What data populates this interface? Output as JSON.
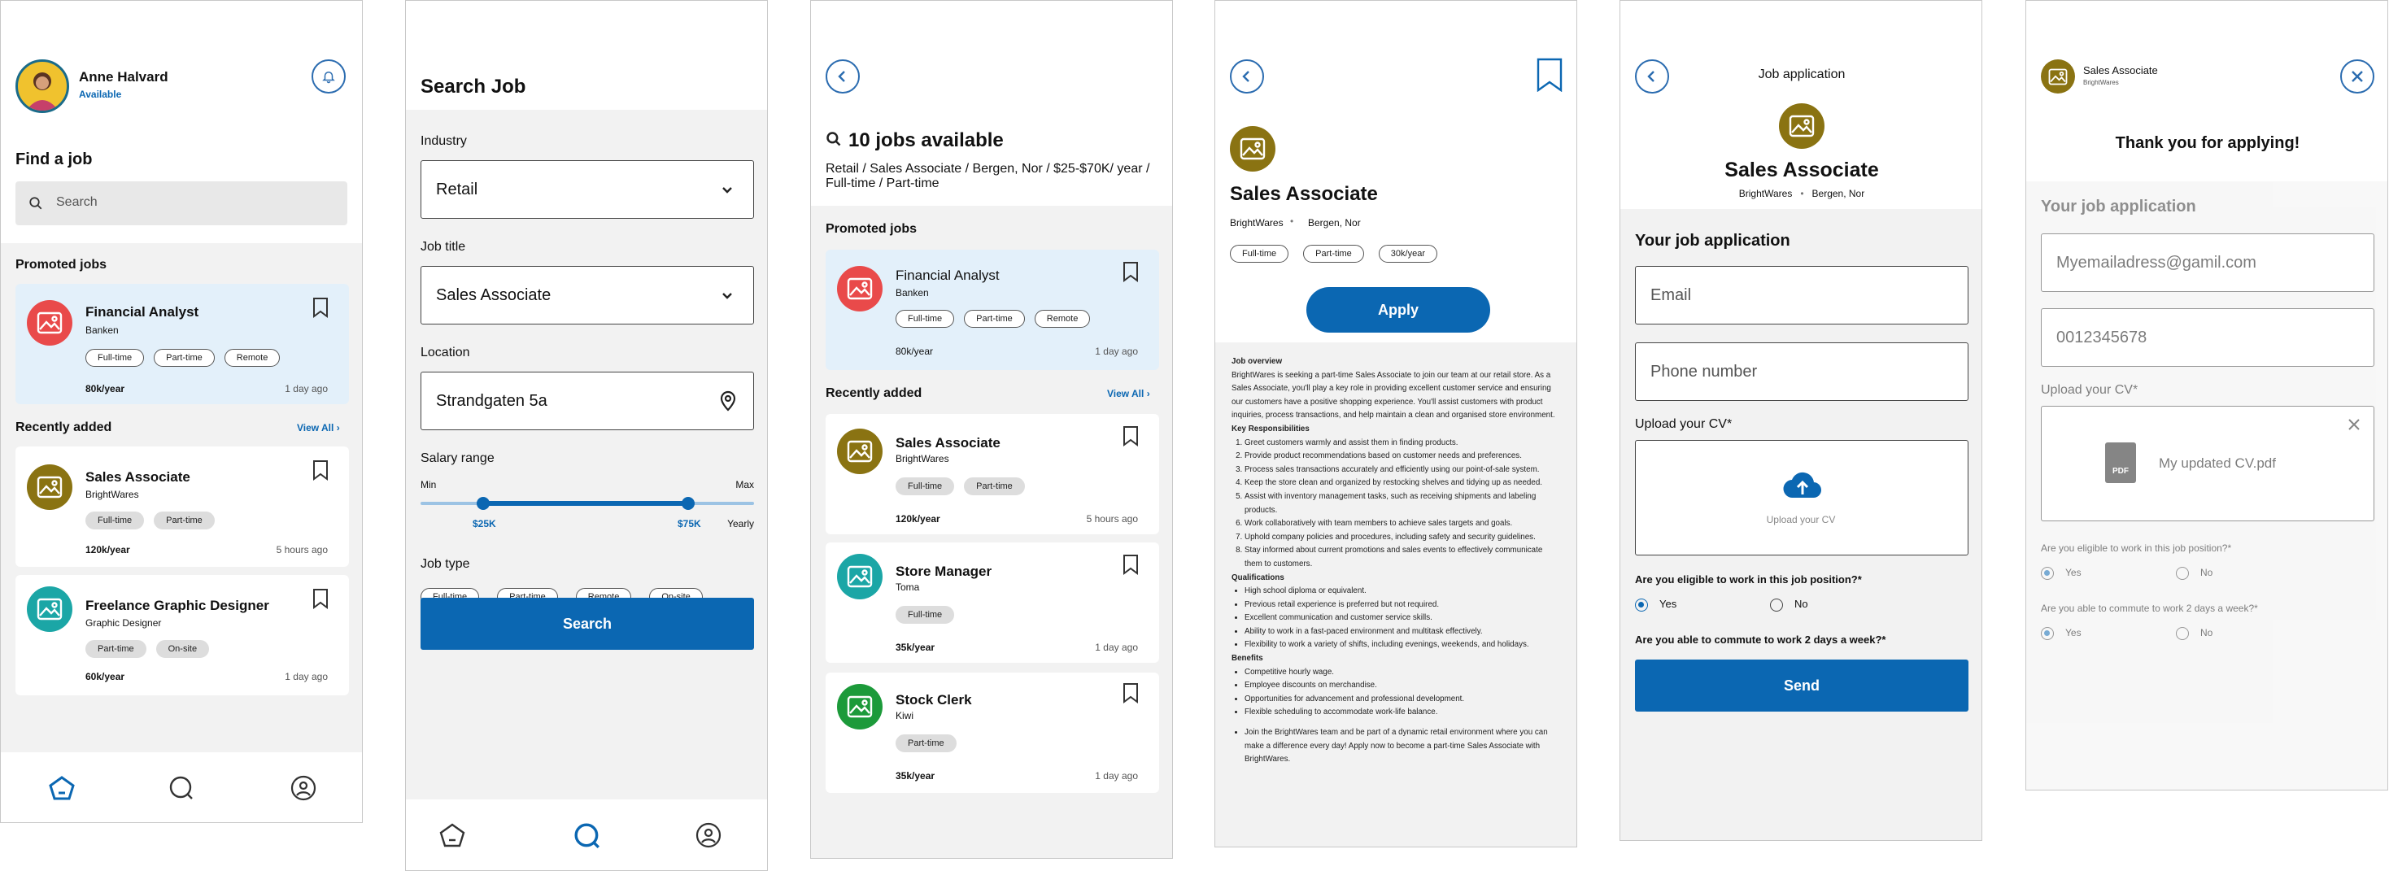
{
  "colors": {
    "brand": "#0b67b2",
    "promoted_bg": "#e3f0fa",
    "gray_bg": "#f2f2f2",
    "red_avatar": "#e94a4a",
    "olive_avatar": "#8a7312",
    "teal_avatar": "#1ba6a6",
    "green_avatar": "#1c9a3a"
  },
  "home": {
    "user_name": "Anne Halvard",
    "user_status": "Available",
    "title": "Find a job",
    "search_placeholder": "Search",
    "promoted_label": "Promoted jobs",
    "promoted": {
      "title": "Financial Analyst",
      "company": "Banken",
      "tags": [
        "Full-time",
        "Part-time",
        "Remote"
      ],
      "salary": "80k/year",
      "time": "1 day ago"
    },
    "recent_label": "Recently added",
    "view_all": "View All",
    "recent": [
      {
        "title": "Sales Associate",
        "company": "BrightWares",
        "tags": [
          "Full-time",
          "Part-time"
        ],
        "salary": "120k/year",
        "time": "5 hours ago"
      },
      {
        "title": "Freelance Graphic Designer",
        "company": "Graphic Designer",
        "tags": [
          "Part-time",
          "On-site"
        ],
        "salary": "60k/year",
        "time": "1 day ago"
      }
    ]
  },
  "search": {
    "title": "Search Job",
    "industry_label": "Industry",
    "industry_value": "Retail",
    "jobtitle_label": "Job title",
    "jobtitle_value": "Sales Associate",
    "location_label": "Location",
    "location_value": "Strandgaten 5a",
    "salary_label": "Salary range",
    "min_label": "Min",
    "max_label": "Max",
    "min_value": "$25K",
    "max_value": "$75K",
    "period": "Yearly",
    "jobtype_label": "Job type",
    "jobtype_chips": [
      "Full-time",
      "Part-time",
      "Remote",
      "On-site"
    ],
    "search_button": "Search"
  },
  "results": {
    "count_title": "10 jobs available",
    "filters": "Retail / Sales Associate / Bergen, Nor / $25-$70K/ year / Full-time / Part-time",
    "promoted_label": "Promoted jobs",
    "promoted": {
      "title": "Financial Analyst",
      "company": "Banken",
      "tags": [
        "Full-time",
        "Part-time",
        "Remote"
      ],
      "salary": "80k/year",
      "time": "1 day ago"
    },
    "recent_label": "Recently added",
    "view_all": "View All",
    "recent": [
      {
        "title": "Sales Associate",
        "company": "BrightWares",
        "tags": [
          "Full-time",
          "Part-time"
        ],
        "salary": "120k/year",
        "time": "5 hours ago"
      },
      {
        "title": "Store Manager",
        "company": "Toma",
        "tags": [
          "Full-time"
        ],
        "salary": "35k/year",
        "time": "1 day ago"
      },
      {
        "title": "Stock Clerk",
        "company": "Kiwi",
        "tags": [
          "Part-time"
        ],
        "salary": "35k/year",
        "time": "1 day ago"
      }
    ]
  },
  "detail": {
    "title": "Sales Associate",
    "company": "BrightWares",
    "location": "Bergen, Nor",
    "tags": [
      "Full-time",
      "Part-time",
      "30k/year"
    ],
    "apply_button": "Apply",
    "overview_h": "Job overview",
    "overview": "BrightWares is seeking a part-time Sales Associate to join our team at our retail store. As a Sales Associate, you'll play a key role in providing excellent customer service and ensuring our customers have a positive shopping experience. You'll assist customers with product inquiries, process transactions, and help maintain a clean and organised store environment.",
    "resp_h": "Key Responsibilities",
    "resp": [
      "Greet customers warmly and assist them in finding products.",
      "Provide product recommendations based on customer needs and preferences.",
      "Process sales transactions accurately and efficiently using our point-of-sale system.",
      "Keep the store clean and organized by restocking shelves and tidying up as needed.",
      "Assist with inventory management tasks, such as receiving shipments and labeling products.",
      "Work collaboratively with team members to achieve sales targets and goals.",
      "Uphold company policies and procedures, including safety and security guidelines.",
      "Stay informed about current promotions and sales events to effectively communicate them to customers."
    ],
    "qual_h": "Qualifications",
    "qual": [
      "High school diploma or equivalent.",
      "Previous retail experience is preferred but not required.",
      "Excellent communication and customer service skills.",
      "Ability to work in a fast-paced environment and multitask effectively.",
      "Flexibility to work a variety of shifts, including evenings, weekends, and holidays."
    ],
    "ben_h": "Benefits",
    "ben": [
      "Competitive hourly wage.",
      "Employee discounts on merchandise.",
      "Opportunities for advancement and professional development.",
      "Flexible scheduling to accommodate work-life balance."
    ],
    "closing": "Join the BrightWares team and be part of a dynamic retail environment where you can make a difference every day! Apply now to become a part-time Sales Associate with BrightWares."
  },
  "application": {
    "header": "Job application",
    "title": "Sales Associate",
    "company": "BrightWares",
    "location": "Bergen, Nor",
    "section": "Your job application",
    "email_placeholder": "Email",
    "phone_placeholder": "Phone number",
    "cv_label": "Upload your CV*",
    "cv_upload": "Upload your CV",
    "q1": "Are you eligible to work in this job position?*",
    "q2": "Are you able to commute to work 2 days a week?*",
    "yes": "Yes",
    "no": "No",
    "send_button": "Send"
  },
  "thanks": {
    "title": "Sales Associate",
    "company": "BrightWares",
    "message": "Thank you for applying!",
    "section": "Your job application",
    "email": "Myemailadress@gamil.com",
    "phone": "0012345678",
    "cv_label": "Upload your CV*",
    "cv_file": "My updated CV.pdf",
    "pdf": "PDF",
    "q1": "Are you eligible to work in this job position?*",
    "q2": "Are you able to commute to work 2 days a week?*",
    "yes": "Yes",
    "no": "No"
  }
}
